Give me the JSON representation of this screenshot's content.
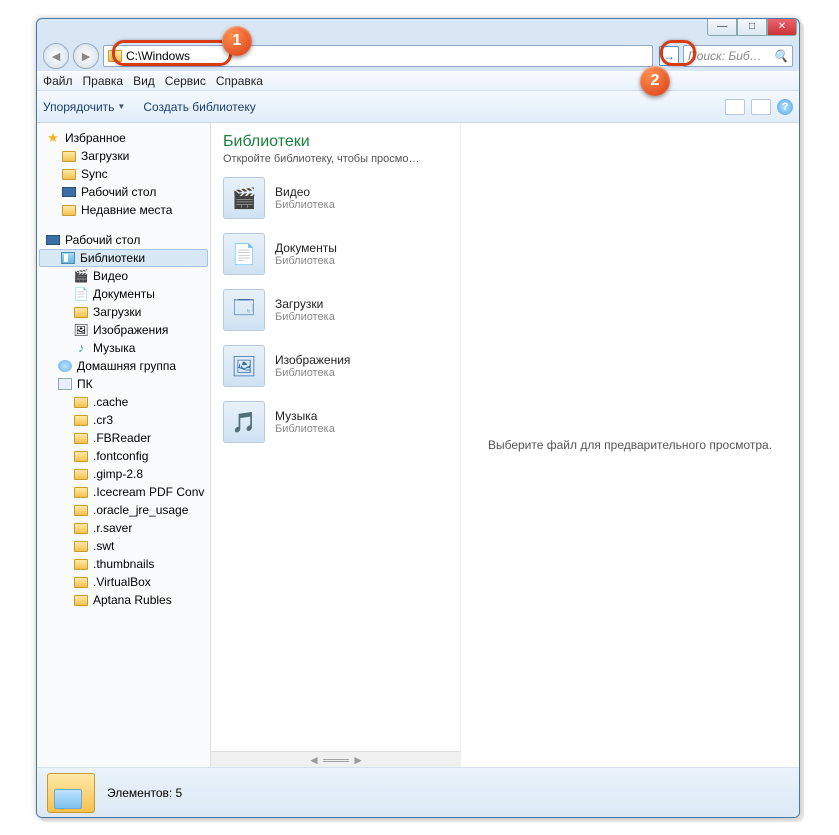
{
  "window_buttons": {
    "minimize": "—",
    "maximize": "□",
    "close": "✕"
  },
  "nav": {
    "back": "◄",
    "forward": "►"
  },
  "address": {
    "value": "C:\\Windows",
    "go": "→"
  },
  "search": {
    "placeholder": "Поиск: Биб…",
    "icon": "🔍"
  },
  "menu": {
    "file": "Файл",
    "edit": "Правка",
    "view": "Вид",
    "tools": "Сервис",
    "help": "Справка"
  },
  "toolbar": {
    "organize": "Упорядочить",
    "create_library": "Создать библиотеку"
  },
  "sidebar": {
    "favorites": {
      "label": "Избранное",
      "items": [
        "Загрузки",
        "Sync",
        "Рабочий стол",
        "Недавние места"
      ]
    },
    "desktop": "Рабочий стол",
    "libraries": {
      "label": "Библиотеки",
      "items": [
        "Видео",
        "Документы",
        "Загрузки",
        "Изображения",
        "Музыка"
      ]
    },
    "homegroup": "Домашняя группа",
    "pc": {
      "label": "ПК",
      "items": [
        ".cache",
        ".cr3",
        ".FBReader",
        ".fontconfig",
        ".gimp-2.8",
        ".Icecream PDF Conv",
        ".oracle_jre_usage",
        ".r.saver",
        ".swt",
        ".thumbnails",
        ".VirtualBox",
        "Aptana Rubles"
      ]
    }
  },
  "content": {
    "title": "Библиотеки",
    "subtitle": "Откройте библиотеку, чтобы просмо…",
    "type_label": "Библиотека",
    "items": [
      {
        "name": "Видео",
        "glyph": "🎬"
      },
      {
        "name": "Документы",
        "glyph": "📄"
      },
      {
        "name": "Загрузки",
        "glyph": "🗔"
      },
      {
        "name": "Изображения",
        "glyph": "🖼"
      },
      {
        "name": "Музыка",
        "glyph": "🎵"
      }
    ]
  },
  "preview": {
    "text": "Выберите файл для предварительного просмотра."
  },
  "footer": {
    "count_label": "Элементов: 5"
  },
  "callouts": {
    "c1": "1",
    "c2": "2"
  }
}
